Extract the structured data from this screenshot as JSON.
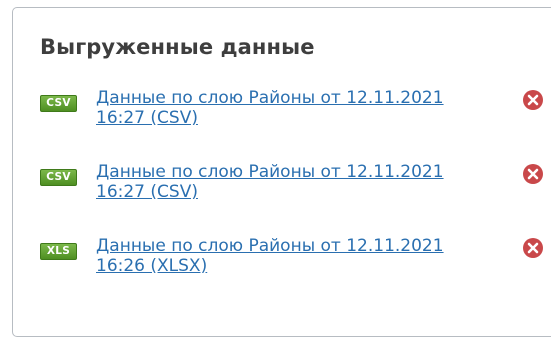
{
  "panel": {
    "title": "Выгруженные данные"
  },
  "exports": [
    {
      "format": "CSV",
      "link_line1": "Данные по слою Районы от 12.11.2021",
      "link_line2": "16:27 (CSV)"
    },
    {
      "format": "CSV",
      "link_line1": "Данные по слою Районы от 12.11.2021",
      "link_line2": "16:27 (CSV)"
    },
    {
      "format": "XLS",
      "link_line1": "Данные по слою Районы от 12.11.2021",
      "link_line2": "16:26 (XLSX)"
    }
  ],
  "icons": {
    "delete": "delete-circle-x-icon",
    "badge_color": "#5b9a2c",
    "delete_color": "#c9484a",
    "link_color": "#2a6fb0"
  }
}
